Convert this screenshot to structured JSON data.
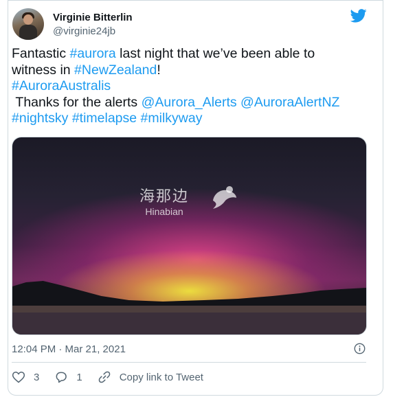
{
  "author": {
    "name": "Virginie Bitterlin",
    "handle": "@virginie24jb"
  },
  "tweet": {
    "line1_prefix": "Fantastic ",
    "line1_tag": "#aurora",
    "line1_suffix": " last night that we’ve been able to",
    "line2_prefix": "witness in ",
    "line2_tag": "#NewZealand",
    "line2_suffix": "!",
    "line3_tag": "#AuroraAustralis",
    "line4_prefix": " Thanks for the alerts ",
    "line4_mention1": "@Aurora_Alerts",
    "line4_mention2": "@AuroraAlertNZ",
    "line5_tag1": "#nightsky",
    "line5_tag2": "#timelapse",
    "line5_tag3": "#milkyway"
  },
  "media": {
    "watermark_cn": "海那边",
    "watermark_en": "Hinabian"
  },
  "meta": {
    "timestamp": "12:04 PM · Mar 21, 2021"
  },
  "actions": {
    "likes": "3",
    "replies": "1",
    "copy_link_label": "Copy link to Tweet"
  },
  "colors": {
    "accent": "#1d9bf0",
    "text": "#0f1419",
    "secondary": "#536471",
    "like": "#f91880"
  },
  "icons": [
    "twitter-bird-icon",
    "info-icon",
    "heart-icon",
    "reply-icon",
    "link-icon"
  ]
}
